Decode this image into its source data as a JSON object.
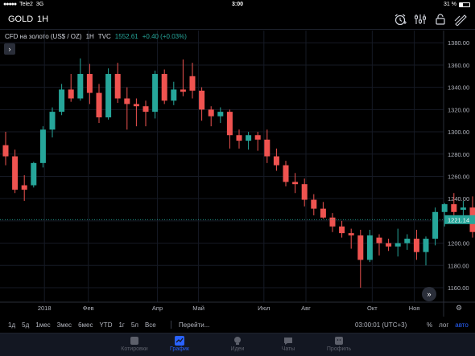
{
  "status_bar": {
    "carrier": "Tele2",
    "network": "3G",
    "time": "3:00",
    "battery": "31 %"
  },
  "toolbar": {
    "symbol": "GOLD",
    "interval": "1H"
  },
  "legend": {
    "name": "CFD на золото (US$ / OZ)",
    "interval": "1H",
    "source": "TVC",
    "price": "1552.61",
    "change": "+0.40 (+0.03%)"
  },
  "chart_data": {
    "type": "candlestick",
    "y_ticks": [
      1380,
      1360,
      1340,
      1320,
      1300,
      1280,
      1260,
      1240,
      1220,
      1200,
      1180,
      1160
    ],
    "ylim": [
      1147,
      1391
    ],
    "x_ticks": [
      {
        "label": "2018",
        "index": 4.5
      },
      {
        "label": "Фев",
        "index": 9.2
      },
      {
        "label": "Апр",
        "index": 16.6
      },
      {
        "label": "Май",
        "index": 21.0
      },
      {
        "label": "Июл",
        "index": 28.0
      },
      {
        "label": "Авг",
        "index": 32.5
      },
      {
        "label": "Окт",
        "index": 39.6
      },
      {
        "label": "Ноя",
        "index": 44.1
      }
    ],
    "current_price": 1221.14,
    "current_price_label": "1221.14",
    "colors": {
      "up": "#26a69a",
      "down": "#ef5350",
      "label_bg": "#26a69a"
    },
    "candles": [
      {
        "o": 1288,
        "h": 1300,
        "l": 1270,
        "c": 1278
      },
      {
        "o": 1278,
        "h": 1284,
        "l": 1245,
        "c": 1248
      },
      {
        "o": 1252,
        "h": 1261,
        "l": 1238,
        "c": 1248
      },
      {
        "o": 1252,
        "h": 1273,
        "l": 1250,
        "c": 1272
      },
      {
        "o": 1272,
        "h": 1305,
        "l": 1268,
        "c": 1302
      },
      {
        "o": 1302,
        "h": 1322,
        "l": 1295,
        "c": 1318
      },
      {
        "o": 1318,
        "h": 1343,
        "l": 1315,
        "c": 1338
      },
      {
        "o": 1338,
        "h": 1352,
        "l": 1327,
        "c": 1330
      },
      {
        "o": 1330,
        "h": 1366,
        "l": 1328,
        "c": 1352
      },
      {
        "o": 1352,
        "h": 1361,
        "l": 1325,
        "c": 1335
      },
      {
        "o": 1335,
        "h": 1343,
        "l": 1308,
        "c": 1313
      },
      {
        "o": 1313,
        "h": 1357,
        "l": 1311,
        "c": 1352
      },
      {
        "o": 1352,
        "h": 1362,
        "l": 1326,
        "c": 1330
      },
      {
        "o": 1330,
        "h": 1340,
        "l": 1302,
        "c": 1325
      },
      {
        "o": 1325,
        "h": 1330,
        "l": 1305,
        "c": 1323
      },
      {
        "o": 1323,
        "h": 1328,
        "l": 1305,
        "c": 1318
      },
      {
        "o": 1318,
        "h": 1355,
        "l": 1312,
        "c": 1352
      },
      {
        "o": 1352,
        "h": 1356,
        "l": 1325,
        "c": 1328
      },
      {
        "o": 1328,
        "h": 1345,
        "l": 1324,
        "c": 1338
      },
      {
        "o": 1338,
        "h": 1365,
        "l": 1332,
        "c": 1336
      },
      {
        "o": 1350,
        "h": 1362,
        "l": 1330,
        "c": 1337
      },
      {
        "o": 1337,
        "h": 1340,
        "l": 1310,
        "c": 1320
      },
      {
        "o": 1320,
        "h": 1323,
        "l": 1305,
        "c": 1314
      },
      {
        "o": 1314,
        "h": 1322,
        "l": 1308,
        "c": 1318
      },
      {
        "o": 1318,
        "h": 1320,
        "l": 1285,
        "c": 1297
      },
      {
        "o": 1297,
        "h": 1302,
        "l": 1285,
        "c": 1292
      },
      {
        "o": 1292,
        "h": 1300,
        "l": 1284,
        "c": 1297
      },
      {
        "o": 1297,
        "h": 1300,
        "l": 1283,
        "c": 1293
      },
      {
        "o": 1293,
        "h": 1302,
        "l": 1272,
        "c": 1278
      },
      {
        "o": 1278,
        "h": 1285,
        "l": 1265,
        "c": 1270
      },
      {
        "o": 1270,
        "h": 1274,
        "l": 1251,
        "c": 1255
      },
      {
        "o": 1255,
        "h": 1263,
        "l": 1245,
        "c": 1253
      },
      {
        "o": 1253,
        "h": 1258,
        "l": 1233,
        "c": 1239
      },
      {
        "o": 1239,
        "h": 1244,
        "l": 1225,
        "c": 1231
      },
      {
        "o": 1231,
        "h": 1237,
        "l": 1222,
        "c": 1223
      },
      {
        "o": 1223,
        "h": 1227,
        "l": 1210,
        "c": 1215
      },
      {
        "o": 1215,
        "h": 1220,
        "l": 1205,
        "c": 1209
      },
      {
        "o": 1209,
        "h": 1213,
        "l": 1195,
        "c": 1207
      },
      {
        "o": 1207,
        "h": 1212,
        "l": 1160,
        "c": 1185
      },
      {
        "o": 1185,
        "h": 1212,
        "l": 1183,
        "c": 1207
      },
      {
        "o": 1205,
        "h": 1208,
        "l": 1189,
        "c": 1200
      },
      {
        "o": 1200,
        "h": 1204,
        "l": 1193,
        "c": 1197
      },
      {
        "o": 1197,
        "h": 1213,
        "l": 1188,
        "c": 1200
      },
      {
        "o": 1200,
        "h": 1208,
        "l": 1194,
        "c": 1204
      },
      {
        "o": 1204,
        "h": 1212,
        "l": 1185,
        "c": 1192
      },
      {
        "o": 1192,
        "h": 1206,
        "l": 1180,
        "c": 1204
      },
      {
        "o": 1204,
        "h": 1232,
        "l": 1198,
        "c": 1228
      },
      {
        "o": 1228,
        "h": 1236,
        "l": 1215,
        "c": 1235
      },
      {
        "o": 1235,
        "h": 1245,
        "l": 1225,
        "c": 1228
      },
      {
        "o": 1230,
        "h": 1238,
        "l": 1222,
        "c": 1232
      },
      {
        "o": 1232,
        "h": 1242,
        "l": 1205,
        "c": 1210
      }
    ]
  },
  "ranges": [
    "1д",
    "5д",
    "1мес",
    "3мес",
    "6мес",
    "YTD",
    "1г",
    "5л",
    "Все"
  ],
  "goto_label": "Перейти...",
  "clock": "03:00:01 (UTC+3)",
  "scale_options": {
    "percent": "%",
    "log": "лог",
    "auto": "авто"
  },
  "tabs": [
    {
      "label": "Котировки",
      "icon": "quotes-icon"
    },
    {
      "label": "График",
      "icon": "chart-icon"
    },
    {
      "label": "Идеи",
      "icon": "ideas-icon"
    },
    {
      "label": "Чаты",
      "icon": "chats-icon"
    },
    {
      "label": "Профиль",
      "icon": "profile-icon"
    }
  ],
  "active_tab": "График"
}
